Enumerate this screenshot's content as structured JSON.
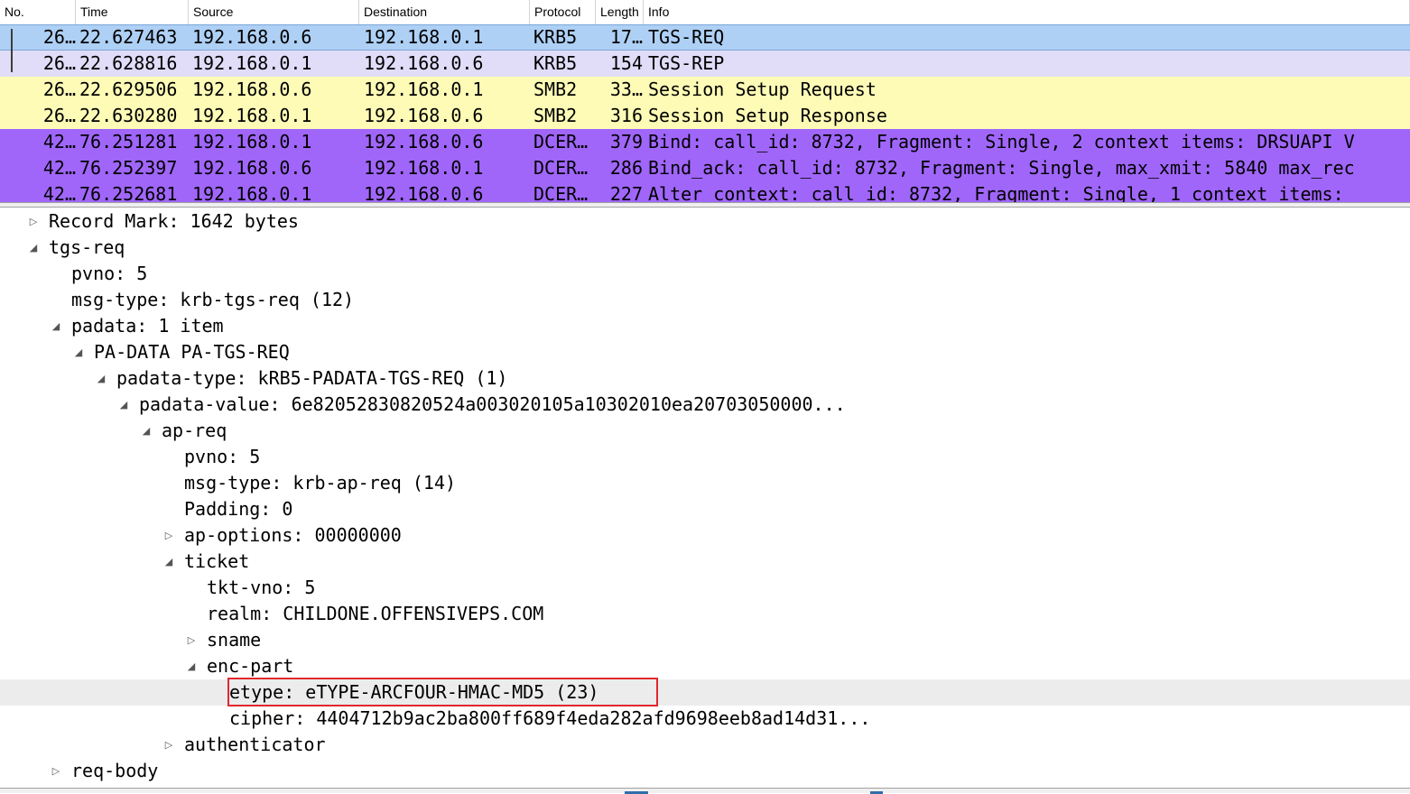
{
  "packet_list": {
    "columns": [
      "No.",
      "Time",
      "Source",
      "Destination",
      "Protocol",
      "Length",
      "Info"
    ],
    "rows": [
      {
        "no": "26…",
        "time": "22.627463",
        "source": "192.168.0.6",
        "destination": "192.168.0.1",
        "protocol": "KRB5",
        "length": "17…",
        "info": "TGS-REQ",
        "bg": "#aed0f5",
        "selected": true,
        "related": true
      },
      {
        "no": "26…",
        "time": "22.628816",
        "source": "192.168.0.1",
        "destination": "192.168.0.6",
        "protocol": "KRB5",
        "length": "154",
        "info": "TGS-REP",
        "bg": "#e1dcf7",
        "related": true
      },
      {
        "no": "26…",
        "time": "22.629506",
        "source": "192.168.0.6",
        "destination": "192.168.0.1",
        "protocol": "SMB2",
        "length": "33…",
        "info": "Session Setup Request",
        "bg": "#fdfbb6"
      },
      {
        "no": "26…",
        "time": "22.630280",
        "source": "192.168.0.1",
        "destination": "192.168.0.6",
        "protocol": "SMB2",
        "length": "316",
        "info": "Session Setup Response",
        "bg": "#fdfbb6"
      },
      {
        "no": "42…",
        "time": "76.251281",
        "source": "192.168.0.1",
        "destination": "192.168.0.6",
        "protocol": "DCER…",
        "length": "379",
        "info": "Bind: call_id: 8732, Fragment: Single, 2 context items: DRSUAPI V",
        "bg": "#a066fa"
      },
      {
        "no": "42…",
        "time": "76.252397",
        "source": "192.168.0.6",
        "destination": "192.168.0.1",
        "protocol": "DCER…",
        "length": "286",
        "info": "Bind_ack: call_id: 8732, Fragment: Single, max_xmit: 5840 max_rec",
        "bg": "#a066fa"
      },
      {
        "no": "42…",
        "time": "76.252681",
        "source": "192.168.0.1",
        "destination": "192.168.0.6",
        "protocol": "DCER…",
        "length": "227",
        "info": "Alter_context: call_id: 8732, Fragment: Single, 1 context items:",
        "bg": "#a066fa"
      }
    ]
  },
  "detail_tree": [
    {
      "level": 1,
      "toggle": "collapsed",
      "text": "Record Mark: 1642 bytes"
    },
    {
      "level": 1,
      "toggle": "expanded",
      "text": "tgs-req"
    },
    {
      "level": 2,
      "toggle": "none",
      "text": "pvno: 5"
    },
    {
      "level": 2,
      "toggle": "none",
      "text": "msg-type: krb-tgs-req (12)"
    },
    {
      "level": 2,
      "toggle": "expanded",
      "text": "padata: 1 item"
    },
    {
      "level": 3,
      "toggle": "expanded",
      "text": "PA-DATA PA-TGS-REQ"
    },
    {
      "level": 4,
      "toggle": "expanded",
      "text": "padata-type: kRB5-PADATA-TGS-REQ (1)"
    },
    {
      "level": 5,
      "toggle": "expanded",
      "text": "padata-value: 6e82052830820524a003020105a10302010ea20703050000..."
    },
    {
      "level": 6,
      "toggle": "expanded",
      "text": "ap-req"
    },
    {
      "level": 7,
      "toggle": "none",
      "text": "pvno: 5"
    },
    {
      "level": 7,
      "toggle": "none",
      "text": "msg-type: krb-ap-req (14)"
    },
    {
      "level": 7,
      "toggle": "none",
      "text": "Padding: 0"
    },
    {
      "level": 7,
      "toggle": "collapsed",
      "text": "ap-options: 00000000"
    },
    {
      "level": 7,
      "toggle": "expanded",
      "text": "ticket"
    },
    {
      "level": 8,
      "toggle": "none",
      "text": "tkt-vno: 5"
    },
    {
      "level": 8,
      "toggle": "none",
      "text": "realm: CHILDONE.OFFENSIVEPS.COM"
    },
    {
      "level": 8,
      "toggle": "collapsed",
      "text": "sname"
    },
    {
      "level": 8,
      "toggle": "expanded",
      "text": "enc-part"
    },
    {
      "level": 9,
      "toggle": "none",
      "text": "etype: eTYPE-ARCFOUR-HMAC-MD5 (23)",
      "selected": true
    },
    {
      "level": 9,
      "toggle": "none",
      "text": "cipher: 4404712b9ac2ba800ff689f4eda282afd9698eeb8ad14d31..."
    },
    {
      "level": 7,
      "toggle": "collapsed",
      "text": "authenticator"
    },
    {
      "level": 2,
      "toggle": "collapsed",
      "text": "req-body"
    }
  ],
  "colors": {
    "highlight_border": "#e0282e",
    "selected_detail_bg": "#ececec"
  }
}
